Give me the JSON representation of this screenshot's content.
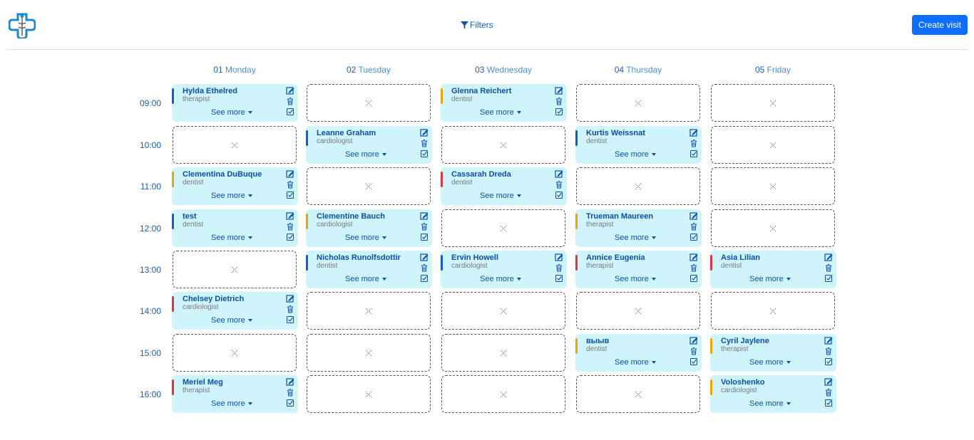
{
  "header": {
    "filters_label": "Filters",
    "create_label": "Create visit",
    "accent": "#0d6efd"
  },
  "days": [
    {
      "num": "01",
      "name": "Monday"
    },
    {
      "num": "02",
      "name": "Tuesday"
    },
    {
      "num": "03",
      "name": "Wednesday"
    },
    {
      "num": "04",
      "name": "Thursday"
    },
    {
      "num": "05",
      "name": "Friday"
    }
  ],
  "times": [
    "09:00",
    "10:00",
    "11:00",
    "12:00",
    "13:00",
    "14:00",
    "15:00",
    "16:00"
  ],
  "see_more_label": "See more",
  "status_colors": {
    "blue": "#0b5ed7",
    "orange": "#f0a500",
    "red": "#dc3545"
  },
  "grid": [
    [
      {
        "name": "Hylda Ethelred",
        "role": "therapist",
        "color": "blue"
      },
      null,
      {
        "name": "Clementina DuBuque",
        "role": "dentist",
        "color": "orange"
      },
      {
        "name": "test",
        "role": "dentist",
        "color": "blue"
      },
      null,
      {
        "name": "Chelsey Dietrich",
        "role": "cardiologist",
        "color": "red"
      },
      null,
      {
        "name": "Meriel Meg",
        "role": "therapist",
        "color": "red"
      }
    ],
    [
      null,
      {
        "name": "Leanne Graham",
        "role": "cardiologist",
        "color": "blue"
      },
      null,
      {
        "name": "Clementine Bauch",
        "role": "cardiologist",
        "color": "orange"
      },
      {
        "name": "Nicholas Runolfsdottir",
        "role": "dentist",
        "color": "blue"
      },
      null,
      null,
      null
    ],
    [
      {
        "name": "Glenna Reichert",
        "role": "dentist",
        "color": "orange"
      },
      null,
      {
        "name": "Cassarah Dreda",
        "role": "dentist",
        "color": "red"
      },
      null,
      {
        "name": "Ervin Howell",
        "role": "cardiologist",
        "color": "blue"
      },
      null,
      null,
      null
    ],
    [
      null,
      {
        "name": "Kurtis Weissnat",
        "role": "dentist",
        "color": "blue"
      },
      null,
      {
        "name": "Trueman Maureen",
        "role": "therapist",
        "color": "orange"
      },
      {
        "name": "Annice Eugenia",
        "role": "therapist",
        "color": "red"
      },
      null,
      {
        "name": "выыв",
        "role": "dentist",
        "color": "orange"
      },
      null
    ],
    [
      null,
      null,
      null,
      null,
      {
        "name": "Asia Lilian",
        "role": "dentist",
        "color": "red"
      },
      null,
      {
        "name": "Cyril Jaylene",
        "role": "therapist",
        "color": "orange"
      },
      {
        "name": "Voloshenko",
        "role": "cardiologist",
        "color": "orange"
      }
    ]
  ]
}
